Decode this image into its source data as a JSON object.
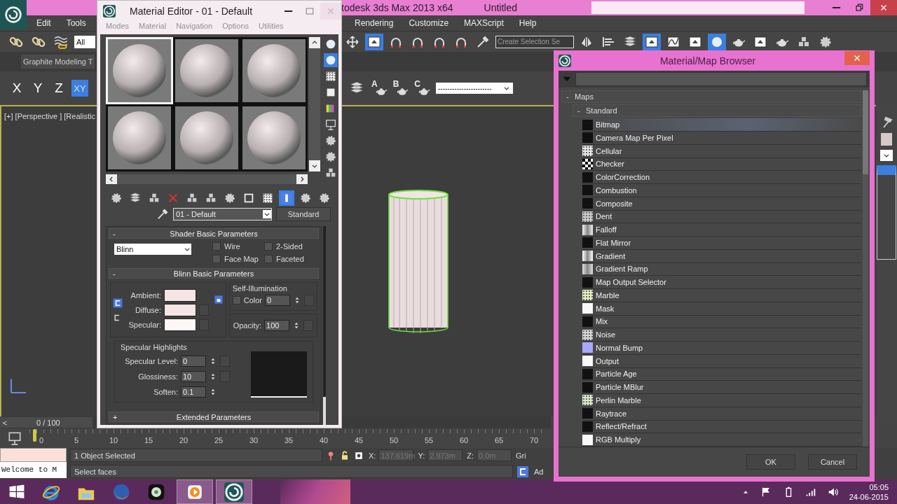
{
  "app_window": {
    "title": "todesk 3ds Max  2013 x64",
    "document": "Untitled",
    "menu_left": [
      "Edit",
      "Tools"
    ],
    "menu_right": [
      "Rendering",
      "Customize",
      "MAXScript",
      "Help"
    ],
    "selection_filter": "All",
    "named_selection": {
      "placeholder": "Create Selection Se"
    },
    "ribbon_tab": "Graphite Modeling T",
    "axes": [
      {
        "label": "X",
        "selected": false
      },
      {
        "label": "Y",
        "selected": false
      },
      {
        "label": "Z",
        "selected": false
      },
      {
        "label": "XY",
        "selected": true
      }
    ],
    "render_presets": [
      "A",
      "B",
      "C"
    ],
    "layer_dropdown": "-----------------------",
    "viewport_label": "[+] [Perspective ] [Realistic",
    "time_slider": {
      "arrow": "<",
      "label": "0 / 100",
      "level": 0
    },
    "ruler_ticks": [
      "0",
      "5",
      "10",
      "15",
      "20",
      "25",
      "30",
      "35",
      "40",
      "45",
      "50",
      "55",
      "60",
      "65",
      "70"
    ],
    "status": {
      "selection": "1 Object Selected",
      "prompt": "Select faces",
      "x_label": "X:",
      "x": "137.619m",
      "y_label": "Y:",
      "y": "2.973m",
      "z_label": "Z:",
      "z": "0.0m",
      "grid": "Gri",
      "add": "Ad"
    },
    "listener": "Welcome to M"
  },
  "material_editor": {
    "title": "Material Editor - 01 - Default",
    "menu": [
      "Modes",
      "Material",
      "Navigation",
      "Options",
      "Utilities"
    ],
    "slots": [
      {
        "selected": true
      },
      {
        "selected": false
      },
      {
        "selected": false
      },
      {
        "selected": false
      },
      {
        "selected": false
      },
      {
        "selected": false
      }
    ],
    "material_name": "01 - Default",
    "material_type": "Standard",
    "shader_rollout": {
      "sign": "-",
      "title": "Shader Basic Parameters",
      "shader": "Blinn",
      "options": [
        {
          "label": "Wire",
          "checked": false
        },
        {
          "label": "2-Sided",
          "checked": false
        },
        {
          "label": "Face Map",
          "checked": false
        },
        {
          "label": "Faceted",
          "checked": false
        }
      ]
    },
    "basic_rollout": {
      "sign": "-",
      "title": "Blinn Basic Parameters",
      "colors": [
        {
          "label": "Ambient:",
          "color": "#f7e4e4"
        },
        {
          "label": "Diffuse:",
          "color": "#f7e4e4"
        },
        {
          "label": "Specular:",
          "color": "#fff6f6"
        }
      ],
      "self_illum": {
        "title": "Self-Illumination",
        "label": "Color",
        "checked": false,
        "value": "0"
      },
      "opacity_label": "Opacity:",
      "opacity": "100",
      "highlights": {
        "title": "Specular Highlights",
        "fields": [
          {
            "label": "Specular Level:",
            "value": "0"
          },
          {
            "label": "Glossiness:",
            "value": "10"
          },
          {
            "label": "Soften:",
            "value": "0.1"
          }
        ]
      }
    },
    "extended_rollout": {
      "sign": "+",
      "title": "Extended Parameters"
    }
  },
  "map_browser": {
    "title": "Material/Map Browser",
    "group": {
      "sign": "-",
      "label": "Maps"
    },
    "subgroup": {
      "sign": "-",
      "label": "Standard"
    },
    "items": [
      {
        "label": "Bitmap",
        "kind": "solid",
        "color": "#111111",
        "selected": true
      },
      {
        "label": "Camera Map Per Pixel",
        "kind": "solid",
        "color": "#111111",
        "selected": false
      },
      {
        "label": "Cellular",
        "kind": "speckle",
        "color": "#e8e8e8",
        "selected": false
      },
      {
        "label": "Checker",
        "kind": "checker",
        "color": "#ffffff",
        "selected": false
      },
      {
        "label": "ColorCorrection",
        "kind": "solid",
        "color": "#111111",
        "selected": false
      },
      {
        "label": "Combustion",
        "kind": "solid",
        "color": "#111111",
        "selected": false
      },
      {
        "label": "Composite",
        "kind": "solid",
        "color": "#111111",
        "selected": false
      },
      {
        "label": "Dent",
        "kind": "speckle",
        "color": "#cccccc",
        "selected": false
      },
      {
        "label": "Falloff",
        "kind": "gradient",
        "color": "#f0f0f0",
        "selected": false
      },
      {
        "label": "Flat Mirror",
        "kind": "solid",
        "color": "#111111",
        "selected": false
      },
      {
        "label": "Gradient",
        "kind": "gradient",
        "color": "#ffffff",
        "selected": false
      },
      {
        "label": "Gradient Ramp",
        "kind": "gradient",
        "color": "#dddddd",
        "selected": false
      },
      {
        "label": "Map Output Selector",
        "kind": "solid",
        "color": "#111111",
        "selected": false
      },
      {
        "label": "Marble",
        "kind": "speckle",
        "color": "#e4f0c0",
        "selected": false
      },
      {
        "label": "Mask",
        "kind": "solid",
        "color": "#f8f8f8",
        "selected": false
      },
      {
        "label": "Mix",
        "kind": "solid",
        "color": "#111111",
        "selected": false
      },
      {
        "label": "Noise",
        "kind": "speckle",
        "color": "#d8d8d8",
        "selected": false
      },
      {
        "label": "Normal Bump",
        "kind": "solid",
        "color": "#a8a8f8",
        "selected": false
      },
      {
        "label": "Output",
        "kind": "solid",
        "color": "#f8f8f8",
        "selected": false
      },
      {
        "label": "Particle Age",
        "kind": "solid",
        "color": "#111111",
        "selected": false
      },
      {
        "label": "Particle MBlur",
        "kind": "solid",
        "color": "#111111",
        "selected": false
      },
      {
        "label": "Perlin Marble",
        "kind": "speckle",
        "color": "#dce8c8",
        "selected": false
      },
      {
        "label": "Raytrace",
        "kind": "solid",
        "color": "#111111",
        "selected": false
      },
      {
        "label": "Reflect/Refract",
        "kind": "solid",
        "color": "#111111",
        "selected": false
      },
      {
        "label": "RGB Multiply",
        "kind": "solid",
        "color": "#f8f8f8",
        "selected": false
      }
    ],
    "buttons": [
      "OK",
      "Cancel"
    ]
  },
  "taskbar": {
    "time": "05:05",
    "date": "24-06-2015"
  }
}
